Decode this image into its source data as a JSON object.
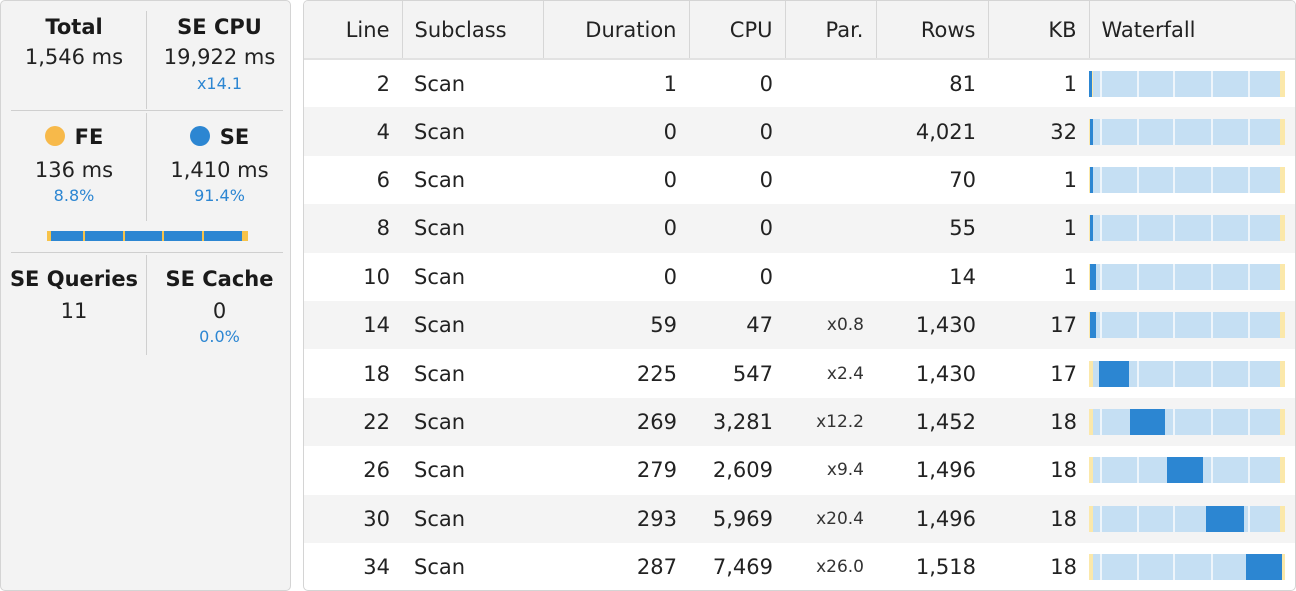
{
  "metrics": {
    "total": {
      "label": "Total",
      "value": "1,546 ms"
    },
    "se_cpu": {
      "label": "SE CPU",
      "value": "19,922 ms",
      "sub": "x14.1"
    },
    "fe": {
      "label": "FE",
      "value": "136 ms",
      "sub": "8.8%",
      "color": "#f7b94a"
    },
    "se": {
      "label": "SE",
      "value": "1,410 ms",
      "sub": "91.4%",
      "color": "#2c86d2"
    },
    "se_queries": {
      "label": "SE Queries",
      "value": "11"
    },
    "se_cache": {
      "label": "SE Cache",
      "value": "0",
      "sub": "0.0%"
    },
    "fe_se_ratio": {
      "fe_fraction": 0.088,
      "se_fraction": 0.914
    }
  },
  "table": {
    "columns": [
      "Line",
      "Subclass",
      "Duration",
      "CPU",
      "Par.",
      "Rows",
      "KB",
      "Waterfall"
    ],
    "rows": [
      {
        "line": "2",
        "subclass": "Scan",
        "duration": "1",
        "cpu": "0",
        "par": "",
        "rows": "81",
        "kb": "1",
        "wf_start": 0.0,
        "wf_len": 0.005
      },
      {
        "line": "4",
        "subclass": "Scan",
        "duration": "0",
        "cpu": "0",
        "par": "",
        "rows": "4,021",
        "kb": "32",
        "wf_start": 0.005,
        "wf_len": 0.005
      },
      {
        "line": "6",
        "subclass": "Scan",
        "duration": "0",
        "cpu": "0",
        "par": "",
        "rows": "70",
        "kb": "1",
        "wf_start": 0.005,
        "wf_len": 0.005
      },
      {
        "line": "8",
        "subclass": "Scan",
        "duration": "0",
        "cpu": "0",
        "par": "",
        "rows": "55",
        "kb": "1",
        "wf_start": 0.005,
        "wf_len": 0.005
      },
      {
        "line": "10",
        "subclass": "Scan",
        "duration": "0",
        "cpu": "0",
        "par": "",
        "rows": "14",
        "kb": "1",
        "wf_start": 0.005,
        "wf_len": 0.03
      },
      {
        "line": "14",
        "subclass": "Scan",
        "duration": "59",
        "cpu": "47",
        "par": "x0.8",
        "rows": "1,430",
        "kb": "17",
        "wf_start": 0.005,
        "wf_len": 0.03
      },
      {
        "line": "18",
        "subclass": "Scan",
        "duration": "225",
        "cpu": "547",
        "par": "x2.4",
        "rows": "1,430",
        "kb": "17",
        "wf_start": 0.05,
        "wf_len": 0.155
      },
      {
        "line": "22",
        "subclass": "Scan",
        "duration": "269",
        "cpu": "3,281",
        "par": "x12.2",
        "rows": "1,452",
        "kb": "18",
        "wf_start": 0.21,
        "wf_len": 0.18
      },
      {
        "line": "26",
        "subclass": "Scan",
        "duration": "279",
        "cpu": "2,609",
        "par": "x9.4",
        "rows": "1,496",
        "kb": "18",
        "wf_start": 0.4,
        "wf_len": 0.185
      },
      {
        "line": "30",
        "subclass": "Scan",
        "duration": "293",
        "cpu": "5,969",
        "par": "x20.4",
        "rows": "1,496",
        "kb": "18",
        "wf_start": 0.595,
        "wf_len": 0.195
      },
      {
        "line": "34",
        "subclass": "Scan",
        "duration": "287",
        "cpu": "7,469",
        "par": "x26.0",
        "rows": "1,518",
        "kb": "18",
        "wf_start": 0.8,
        "wf_len": 0.185
      }
    ]
  }
}
